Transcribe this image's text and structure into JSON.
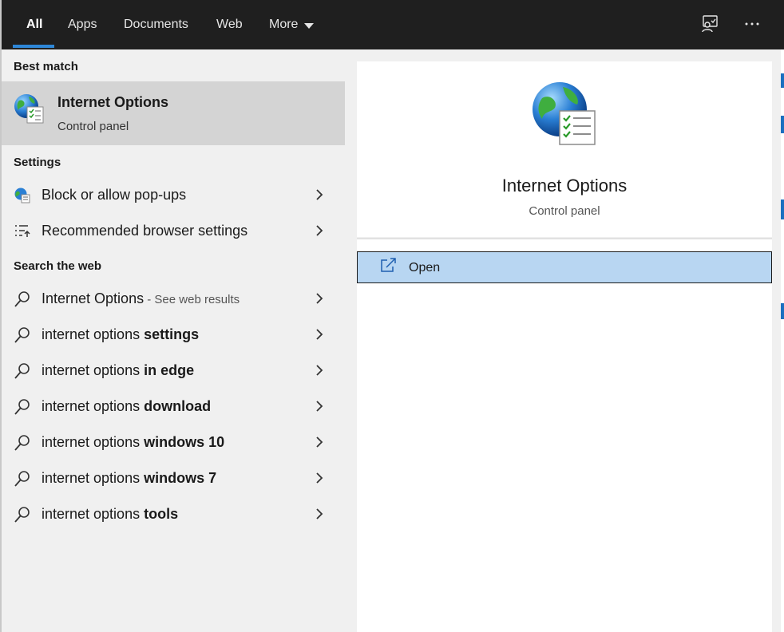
{
  "tabs": [
    {
      "label": "All",
      "active": true
    },
    {
      "label": "Apps",
      "active": false
    },
    {
      "label": "Documents",
      "active": false
    },
    {
      "label": "Web",
      "active": false
    },
    {
      "label": "More",
      "active": false
    }
  ],
  "top_icons": {
    "feedback": "feedback-icon",
    "more": "more-options-icon"
  },
  "sections": {
    "best_match": "Best match",
    "settings": "Settings",
    "search_web": "Search the web"
  },
  "best_match": {
    "name": "Internet Options",
    "sub": "Control panel"
  },
  "settings_items": [
    {
      "label": "Block or allow pop-ups",
      "icon": "globe-settings-icon"
    },
    {
      "label": "Recommended browser settings",
      "icon": "list-settings-icon"
    }
  ],
  "web_items": [
    {
      "plain": "Internet Options",
      "bold": "",
      "hint": " - See web results"
    },
    {
      "plain": "internet options ",
      "bold": "settings",
      "hint": ""
    },
    {
      "plain": "internet options ",
      "bold": "in edge",
      "hint": ""
    },
    {
      "plain": "internet options ",
      "bold": "download",
      "hint": ""
    },
    {
      "plain": "internet options ",
      "bold": "windows 10",
      "hint": ""
    },
    {
      "plain": "internet options ",
      "bold": "windows 7",
      "hint": ""
    },
    {
      "plain": "internet options ",
      "bold": "tools",
      "hint": ""
    }
  ],
  "preview": {
    "title": "Internet Options",
    "sub": "Control panel",
    "open_label": "Open"
  },
  "colors": {
    "topbar": "#1f1f1f",
    "accent": "#2e87d8",
    "selected": "#d4d4d4",
    "open_button": "#b8d6f2"
  }
}
